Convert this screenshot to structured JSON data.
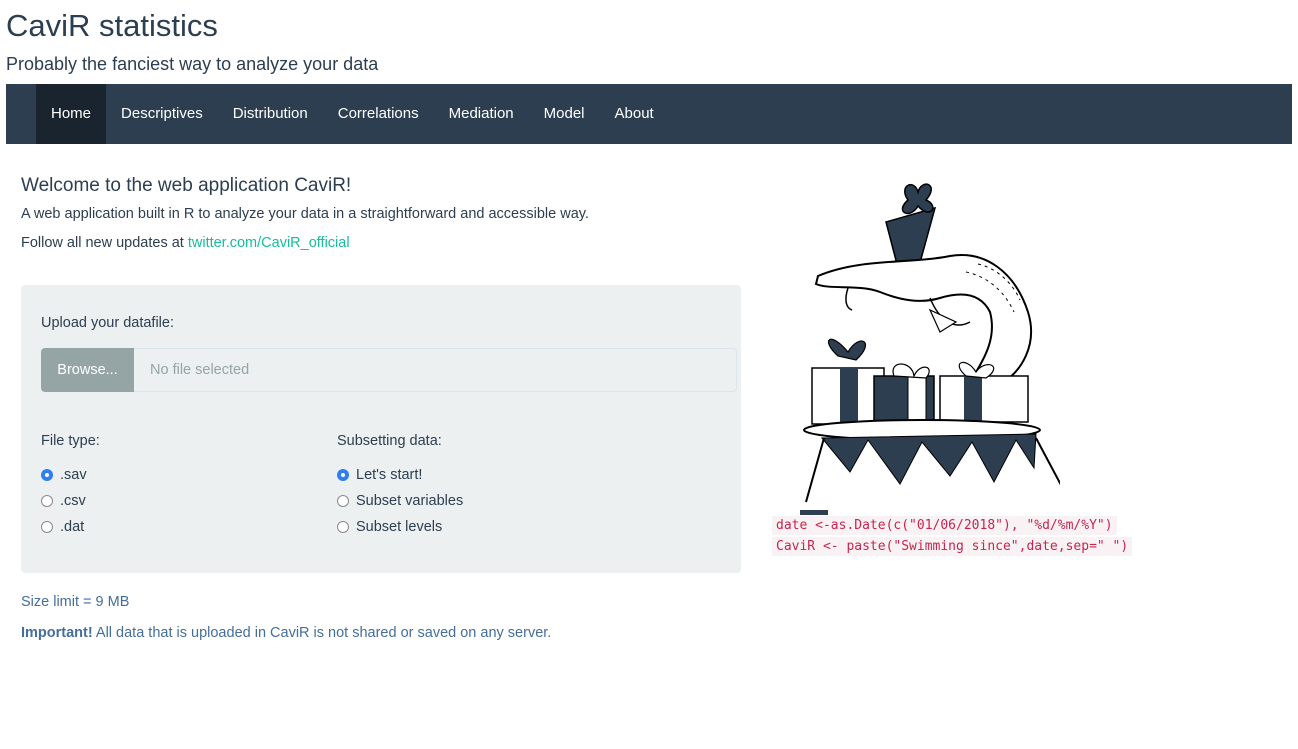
{
  "header": {
    "title": "CaviR statistics",
    "subtitle": "Probably the fanciest way to analyze your data"
  },
  "nav": {
    "active": "Home",
    "items": [
      "Home",
      "Descriptives",
      "Distribution",
      "Correlations",
      "Mediation",
      "Model",
      "About"
    ]
  },
  "main": {
    "welcome_title": "Welcome to the web application CaviR!",
    "intro": "A web application built in R to analyze your data in a straightforward and accessible way.",
    "follow_prefix": "Follow all new updates at ",
    "follow_link": "twitter.com/CaviR_official"
  },
  "upload": {
    "label": "Upload your datafile:",
    "browse_label": "Browse...",
    "placeholder": "No file selected"
  },
  "file_type": {
    "label": "File type:",
    "options": [
      ".sav",
      ".csv",
      ".dat"
    ],
    "selected": ".sav"
  },
  "subsetting": {
    "label": "Subsetting data:",
    "options": [
      "Let's start!",
      "Subset variables",
      "Subset levels"
    ],
    "selected": "Let's start!"
  },
  "notes": {
    "size_limit": "Size limit = 9 MB",
    "important_label": "Important!",
    "important_text": " All data that is uploaded in CaviR is not shared or saved on any server."
  },
  "code": {
    "line1": "date <-as.Date(c(\"01/06/2018\"), \"%d/%m/%Y\")",
    "line2": "CaviR <- paste(\"Swimming since\",date,sep=\" \")"
  },
  "colors": {
    "navbar": "#2c3e50",
    "nav_active": "#1a242f",
    "link": "#18bc9c",
    "well": "#ecf0f1",
    "browse_button": "#95a5a6",
    "radio_checked": "#2e7ff1",
    "note_text": "#446e9b",
    "code_text": "#c7254e"
  }
}
